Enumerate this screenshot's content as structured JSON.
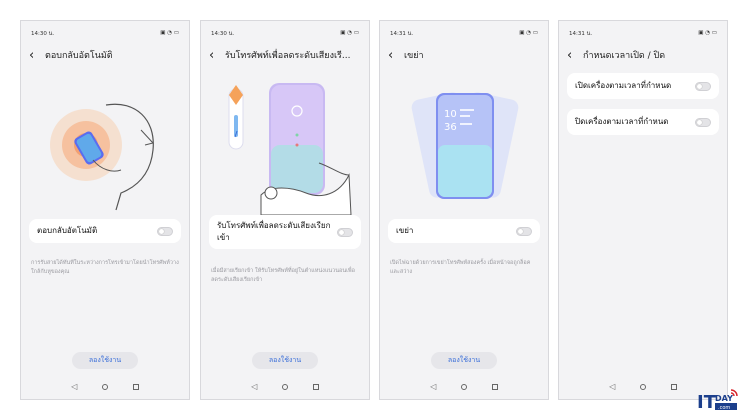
{
  "screens": [
    {
      "time": "14:30 น.",
      "status_icons": "▣ ◔ ▭",
      "title": "ตอบกลับอัตโนมัติ",
      "toggle_label": "ตอบกลับอัตโนมัติ",
      "toggle_on": false,
      "description": "การรับสายได้ทันทีในระหว่างการโทรเข้ามาโดยนำโทรศัพท์วางใกล้กับหูของคุณ",
      "try_label": "ลองใช้งาน"
    },
    {
      "time": "14:30 น.",
      "status_icons": "▣ ◔ ▭",
      "title": "รับโทรศัพท์เพื่อลดระดับเสียงเรี...",
      "toggle_label": "รับโทรศัพท์เพื่อลดระดับเสียงเรียกเข้า",
      "toggle_on": false,
      "description": "เมื่อมีสายเรียกเข้า ให้รับโทรศัพท์ที่อยู่ในตำแหน่งแนวนอนเพื่อลดระดับเสียงเรียกเข้า",
      "try_label": "ลองใช้งาน"
    },
    {
      "time": "14:31 น.",
      "status_icons": "▣ ◔ ▭",
      "title": "เขย่า",
      "toggle_label": "เขย่า",
      "toggle_on": false,
      "description": "เปิดไฟฉายด้วยการเขย่าโทรศัพท์สองครั้ง เมื่อหน้าจอถูกล็อคและสว่าง",
      "try_label": "ลองใช้งาน",
      "clock": {
        "hour": "10",
        "minute": "36"
      }
    },
    {
      "time": "14:31 น.",
      "status_icons": "▣ ◔ ▭",
      "title": "กำหนดเวลาเปิด / ปิด",
      "items": [
        {
          "label": "เปิดเครื่องตามเวลาที่กำหนด",
          "on": false
        },
        {
          "label": "ปิดเครื่องตามเวลาที่กำหนด",
          "on": false
        }
      ]
    }
  ],
  "nav": {
    "back": "◁",
    "home": "○",
    "recent": "□"
  },
  "logo": {
    "text_it": "IT",
    "text_day": "DAY",
    "sub": ".com"
  }
}
